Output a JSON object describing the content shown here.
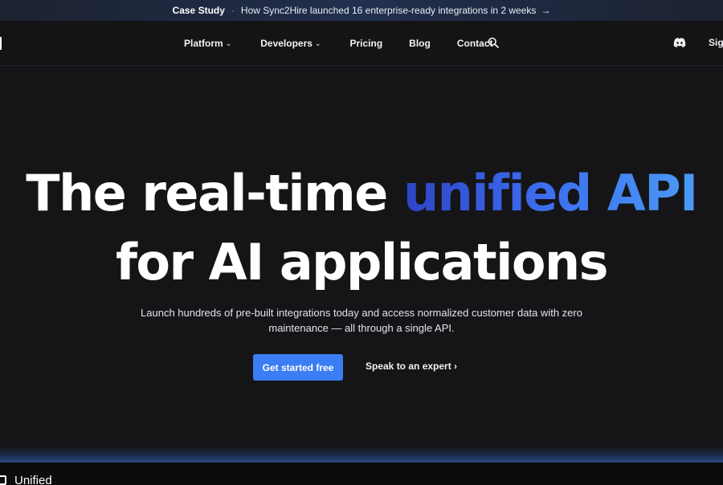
{
  "announcement": {
    "tag": "Case Study",
    "separator": "·",
    "text": "How Sync2Hire launched 16 enterprise-ready integrations in 2 weeks",
    "arrow": "→"
  },
  "nav": {
    "items": [
      {
        "label": "Platform",
        "has_dropdown": true
      },
      {
        "label": "Developers",
        "has_dropdown": true
      },
      {
        "label": "Pricing",
        "has_dropdown": false
      },
      {
        "label": "Blog",
        "has_dropdown": false
      },
      {
        "label": "Contact",
        "has_dropdown": false
      }
    ],
    "chevron": "⌄",
    "signin_label": "Sign"
  },
  "hero": {
    "title_part1": "The real-time ",
    "title_accent": "unified API",
    "title_line2": "for AI applications",
    "subtitle": "Launch hundreds of pre-built integrations today and access normalized customer data with zero maintenance — all through a single API.",
    "cta_primary": "Get started free",
    "cta_secondary": "Speak to an expert ›"
  },
  "footer": {
    "brand": "Unified"
  },
  "colors": {
    "background": "#151518",
    "accent_blue": "#3b7df2",
    "accent_gradient_start": "#2e45c7",
    "accent_gradient_end": "#4a9bf5"
  }
}
